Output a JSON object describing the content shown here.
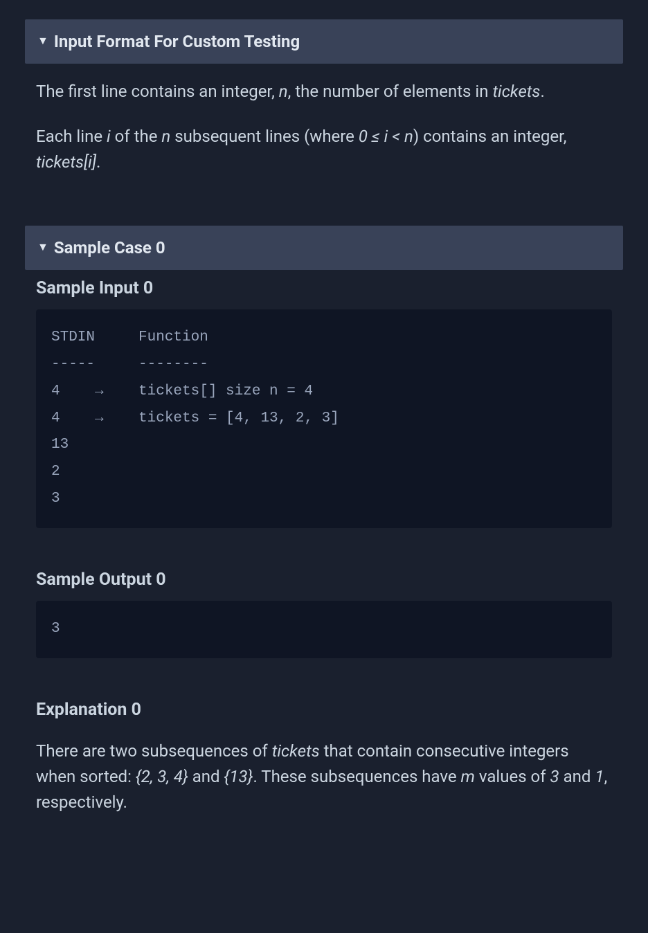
{
  "sections": {
    "input_format": {
      "header": "Input Format For Custom Testing",
      "para1_a": "The first line contains an integer, ",
      "para1_n": "n",
      "para1_b": ", the number of elements in ",
      "para1_tickets": "tickets",
      "para1_c": ".",
      "para2_a": "Each line ",
      "para2_i": "i",
      "para2_b": " of the ",
      "para2_n": "n",
      "para2_c": " subsequent lines (where ",
      "para2_cond": "0 ≤ i < n",
      "para2_d": ") contains an integer, ",
      "para2_ti": "tickets[i]",
      "para2_e": "."
    },
    "sample0": {
      "header": "Sample Case 0",
      "input_label": "Sample Input 0",
      "input_code": "STDIN     Function\n-----     --------\n4    →    tickets[] size n = 4\n4    →    tickets = [4, 13, 2, 3]\n13\n2\n3",
      "output_label": "Sample Output 0",
      "output_code": "3",
      "explanation_label": "Explanation 0",
      "exp_a": "There are two subsequences of ",
      "exp_tickets": "tickets",
      "exp_b": " that contain consecutive integers when sorted: ",
      "exp_set1": "{2, 3, 4}",
      "exp_c": " and ",
      "exp_set2": "{13}",
      "exp_d": ". These subsequences have ",
      "exp_m": "m",
      "exp_e": " values of ",
      "exp_v1": "3",
      "exp_f": " and ",
      "exp_v2": "1",
      "exp_g": ", respectively."
    }
  }
}
